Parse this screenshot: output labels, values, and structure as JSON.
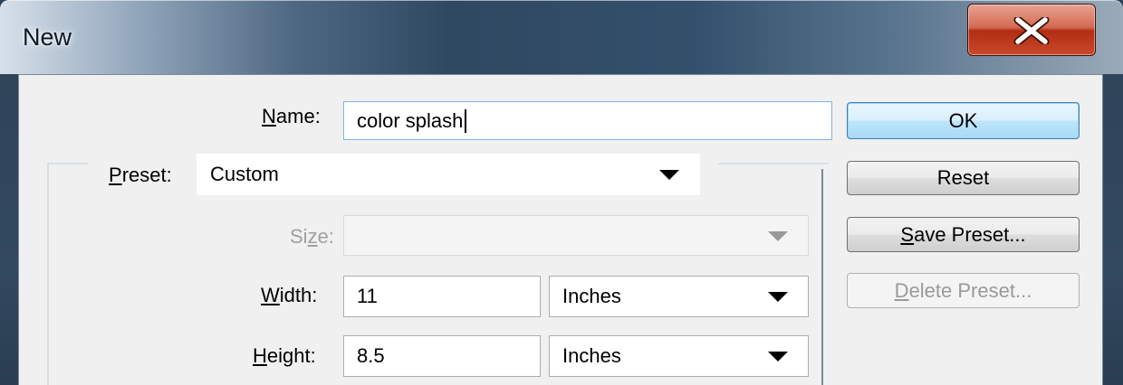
{
  "dialog": {
    "title": "New",
    "close_icon": "close-x-icon"
  },
  "form": {
    "name_label_mn": "N",
    "name_label_rest": "ame:",
    "name_value": "color splash",
    "preset_label_mn": "P",
    "preset_label_rest": "reset:",
    "preset_value": "Custom",
    "size_label_pre": "Si",
    "size_label_mn": "z",
    "size_label_post": "e:",
    "size_value": "",
    "width_label_mn": "W",
    "width_label_rest": "idth:",
    "width_value": "11",
    "width_unit": "Inches",
    "height_label_mn": "H",
    "height_label_rest": "eight:",
    "height_value": "8.5",
    "height_unit": "Inches"
  },
  "buttons": {
    "ok": "OK",
    "reset": "Reset",
    "save_preset_mn": "S",
    "save_preset_rest": "ave Preset...",
    "delete_preset_mn": "D",
    "delete_preset_rest": "elete Preset..."
  },
  "colors": {
    "title_bar": "#2f4862",
    "close_button": "#c9492b",
    "client_background": "#f0f0f0",
    "default_button_border": "#3c7fb1"
  }
}
